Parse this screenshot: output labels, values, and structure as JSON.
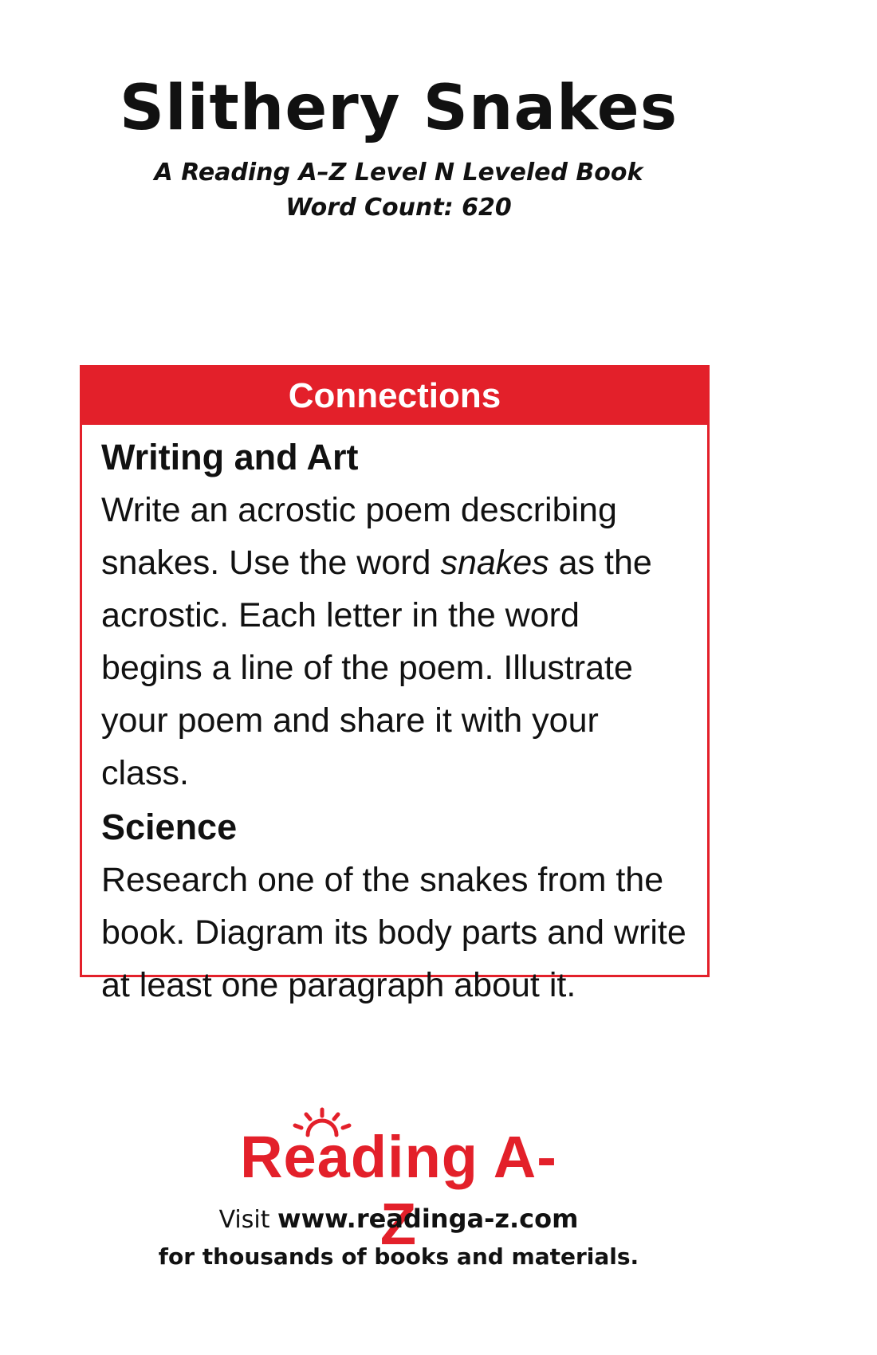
{
  "title": "Slithery Snakes",
  "subtitle_line1": "A Reading A–Z Level N Leveled Book",
  "subtitle_line2": "Word Count: 620",
  "connections": {
    "header": "Connections",
    "sections": [
      {
        "heading": "Writing and Art",
        "text_before": "Write an acrostic poem describing snakes. Use the word ",
        "text_emphasis": "snakes",
        "text_after": " as the acrostic. Each letter in the word begins a line of the poem. Illustrate your poem and share it with your class."
      },
      {
        "heading": "Science",
        "text": "Research one of the snakes from the book. Diagram its body parts and write at least one paragraph about it."
      }
    ]
  },
  "logo": {
    "text": "Reading A-Z",
    "color": "#e3202a",
    "icon": "sun-icon"
  },
  "footer": {
    "visit_label": "Visit ",
    "url": "www.readinga-z.com",
    "tagline": "for thousands of books and materials."
  },
  "colors": {
    "accent": "#e3202a",
    "text": "#111111",
    "background": "#ffffff"
  }
}
